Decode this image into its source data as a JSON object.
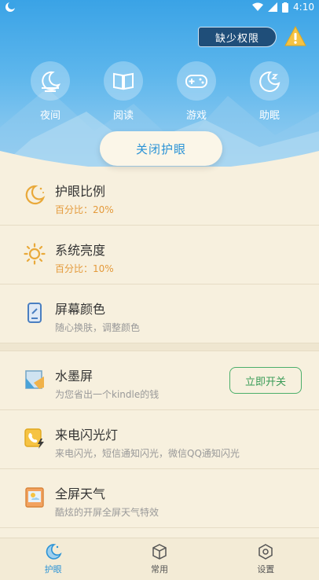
{
  "status_bar": {
    "time": "4:10"
  },
  "header": {
    "permission_label": "缺少权限",
    "modes": [
      {
        "label": "夜间",
        "icon": "night-mode-icon"
      },
      {
        "label": "阅读",
        "icon": "book-icon"
      },
      {
        "label": "游戏",
        "icon": "gamepad-icon"
      },
      {
        "label": "助眠",
        "icon": "sleep-moon-icon"
      }
    ],
    "toggle_label": "关闭护眼"
  },
  "items": [
    {
      "title": "护眼比例",
      "subtitle": "百分比：20%",
      "icon": "moon-icon"
    },
    {
      "title": "系统亮度",
      "subtitle": "百分比：10%",
      "icon": "sun-icon"
    },
    {
      "title": "屏幕颜色",
      "subtitle": "随心换肤，调整颜色",
      "icon": "phone-color-icon"
    },
    {
      "title": "水墨屏",
      "subtitle": "为您省出一个kindle的钱",
      "icon": "ink-screen-icon",
      "button": "立即开关"
    },
    {
      "title": "来电闪光灯",
      "subtitle": "来电闪光，短信通知闪光，微信QQ通知闪光",
      "icon": "call-flash-icon"
    },
    {
      "title": "全屏天气",
      "subtitle": "酷炫的开屏全屏天气特效",
      "icon": "weather-icon"
    }
  ],
  "bottom_nav": [
    {
      "label": "护眼",
      "icon": "eye-care-moon-icon",
      "active": true
    },
    {
      "label": "常用",
      "icon": "cube-icon",
      "active": false
    },
    {
      "label": "设置",
      "icon": "settings-hexagon-icon",
      "active": false
    }
  ],
  "colors": {
    "header": "#3aa3e6",
    "accent": "#2b93d6",
    "orange": "#e49a3b",
    "green": "#4caf6a",
    "background": "#f7f0de"
  }
}
